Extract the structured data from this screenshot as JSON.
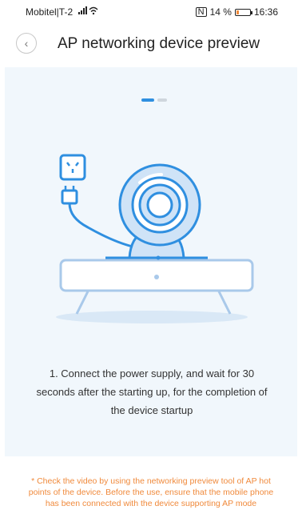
{
  "status_bar": {
    "carrier": "Mobitel|T-2",
    "nfc_label": "N",
    "battery_percent_text": "14 %",
    "battery_level": 0.14,
    "time": "16:36"
  },
  "header": {
    "back_icon": "chevron-left-icon",
    "title": "AP networking device preview"
  },
  "pager": {
    "total": 2,
    "active_index": 0
  },
  "step_text": "1. Connect the power supply, and wait for 30 seconds after the starting up, for the completion of the device startup",
  "note_text": "* Check the video by using the networking preview tool of AP hot points of the device. Before the use, ensure that the mobile phone has been connected with the device supporting AP mode",
  "colors": {
    "accent": "#2f8fe0",
    "note": "#f08a3c",
    "card_bg": "#f1f7fc"
  }
}
